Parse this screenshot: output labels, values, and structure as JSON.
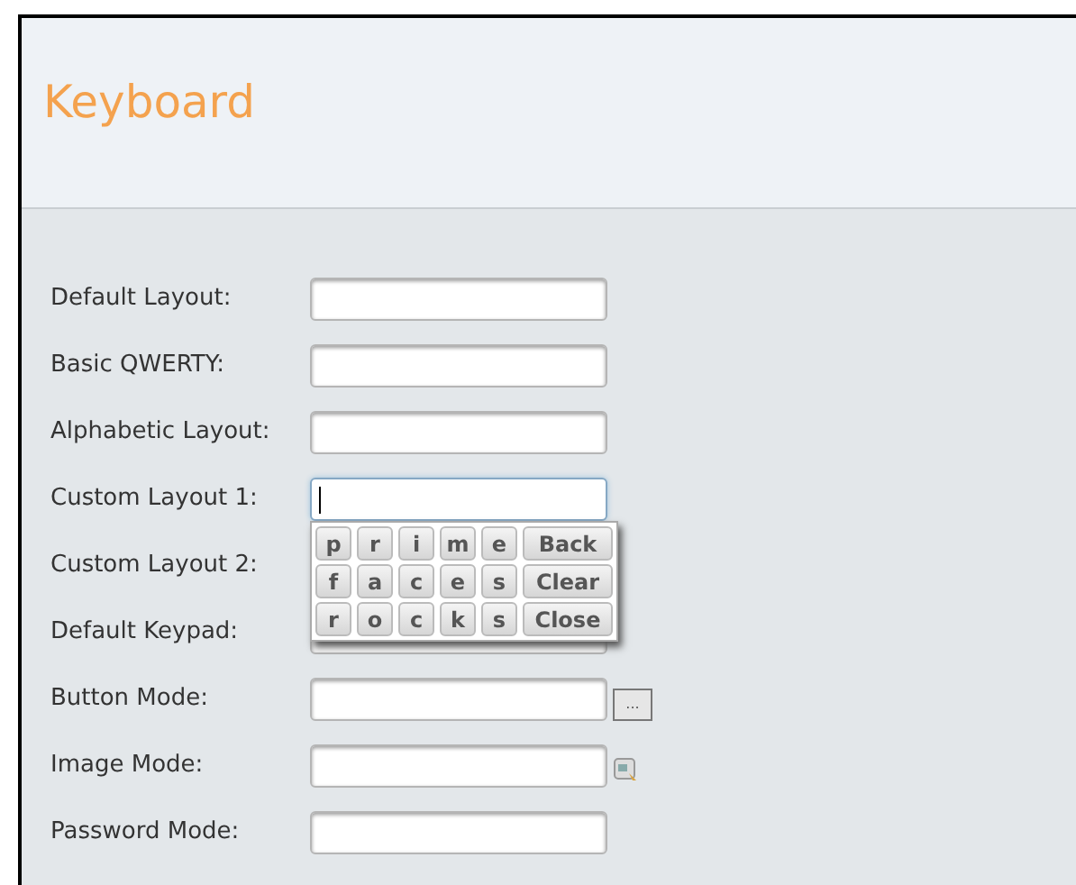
{
  "title": "Keyboard",
  "rows": [
    {
      "label": "Default Layout:",
      "kind": "text",
      "focused": false
    },
    {
      "label": "Basic QWERTY:",
      "kind": "text",
      "focused": false
    },
    {
      "label": "Alphabetic Layout:",
      "kind": "text",
      "focused": false
    },
    {
      "label": "Custom Layout 1:",
      "kind": "text",
      "focused": true
    },
    {
      "label": "Custom Layout 2:",
      "kind": "covered"
    },
    {
      "label": "Default Keypad:",
      "kind": "text",
      "focused": false
    },
    {
      "label": "Button Mode:",
      "kind": "button",
      "focused": false,
      "button": "..."
    },
    {
      "label": "Image Mode:",
      "kind": "image",
      "focused": false
    },
    {
      "label": "Password Mode:",
      "kind": "text",
      "focused": false
    }
  ],
  "keypad": {
    "rows": [
      {
        "keys": [
          "p",
          "r",
          "i",
          "m",
          "e"
        ],
        "action": "Back"
      },
      {
        "keys": [
          "f",
          "a",
          "c",
          "e",
          "s"
        ],
        "action": "Clear"
      },
      {
        "keys": [
          "r",
          "o",
          "c",
          "k",
          "s"
        ],
        "action": "Close"
      }
    ]
  }
}
